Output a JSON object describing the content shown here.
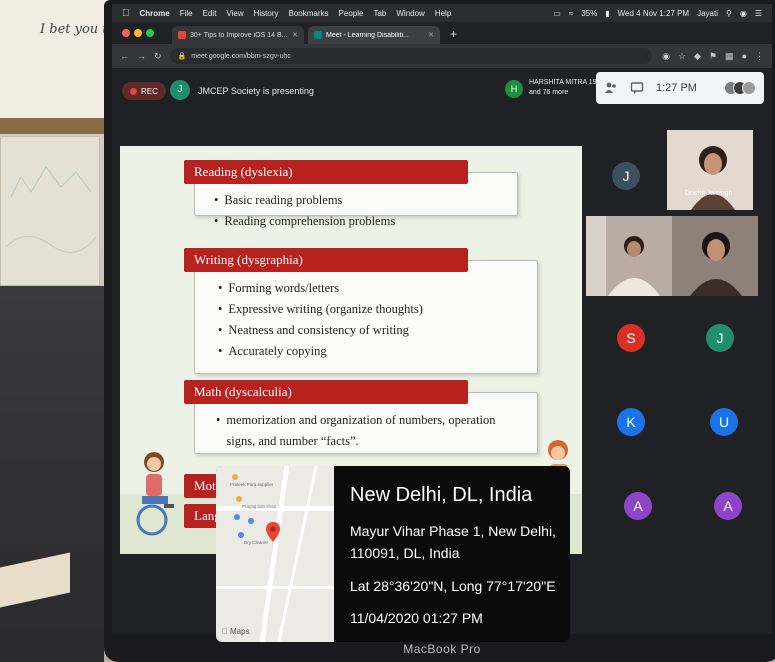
{
  "room": {
    "note_text": "I bet you thought"
  },
  "laptop": {
    "brand": "MacBook Pro"
  },
  "menubar": {
    "app_name": "Chrome",
    "items": [
      "File",
      "Edit",
      "View",
      "History",
      "Bookmarks",
      "People",
      "Tab",
      "Window",
      "Help"
    ],
    "battery": "35%",
    "datetime": "Wed 4 Nov 1:27 PM",
    "user": "Jayati"
  },
  "tabs": [
    {
      "title": "30+ Tips to Improve iOS 14 B...",
      "active": false,
      "color": "#ea4335"
    },
    {
      "title": "Meet - Learning Disabiliti...",
      "active": true,
      "color": "#00897b"
    }
  ],
  "address": {
    "url": "meet.google.com/bbm-szgv-uhc"
  },
  "meet": {
    "rec_label": "REC",
    "presenter_initial": "J",
    "presenting_text": "JMCEP Society is presenting",
    "participant_initial": "H",
    "participant_line1": "HARSHITA MITRA 19...",
    "participant_line2": "and 76 more",
    "time": "1:27 PM"
  },
  "slide": {
    "sections": [
      {
        "title": "Reading (dyslexia)",
        "bullets": [
          "Basic reading problems",
          "Reading comprehension problems"
        ]
      },
      {
        "title": "Writing (dysgraphia)",
        "bullets": [
          "Forming words/letters",
          "Expressive writing (organize thoughts)",
          "Neatness and consistency of writing",
          "Accurately copying"
        ]
      },
      {
        "title": "Math (dyscalculia)",
        "bullets": [
          "memorization and organization of numbers, operation",
          "signs, and number “facts”."
        ]
      },
      {
        "title": "Moto"
      },
      {
        "title": "Langu"
      }
    ]
  },
  "participants": {
    "j_top": {
      "initial": "J",
      "color": "#3c4f5c"
    },
    "video_name": "Drishti Jaisingh",
    "tiles": [
      {
        "initial": "S",
        "color": "#d93025"
      },
      {
        "initial": "J",
        "color": "#1e8e6e"
      },
      {
        "initial": "K",
        "color": "#1a73e8"
      },
      {
        "initial": "U",
        "color": "#1a73e8"
      },
      {
        "initial": "A",
        "color": "#8e44c9"
      },
      {
        "initial": "A",
        "color": "#8e44c9"
      }
    ]
  },
  "location": {
    "city": "New Delhi, DL, India",
    "address": "Mayur Vihar Phase 1, New Delhi, 110091, DL, India",
    "coords": "Lat 28°36'20\"N, Long 77°17'20\"E",
    "datetime": "11/04/2020 01:27 PM",
    "maps_label": "Maps",
    "map_labels": [
      "Prateek Para supplier",
      "Prayag pan shop",
      "Dry Cleaner"
    ]
  }
}
